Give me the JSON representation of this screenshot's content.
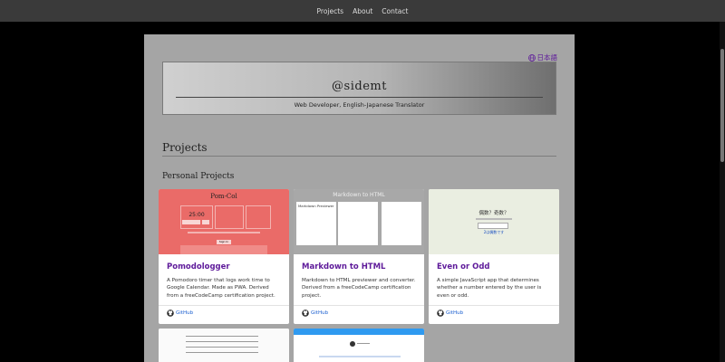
{
  "nav": {
    "items": [
      "Projects",
      "About",
      "Contact"
    ]
  },
  "language": {
    "label": "日本語",
    "icon": "globe-icon"
  },
  "hero": {
    "title": "@sidemt",
    "subtitle": "Web Developer, English-Japanese Translator"
  },
  "sections": {
    "projects": "Projects",
    "personal": "Personal Projects"
  },
  "cards": [
    {
      "title": "Pomodologger",
      "description": "A Pomodoro timer that logs work time to Google Calendar. Made as PWA. Derived from a freeCodeCamp certification project.",
      "link": "GitHub",
      "thumb": {
        "title": "Pom-Col",
        "time": "25:00",
        "button": "Sign In"
      }
    },
    {
      "title": "Markdown to HTML",
      "description": "Markdown to HTML previewer and converter. Derived from a freeCodeCamp certification project.",
      "link": "GitHub",
      "thumb": {
        "title": "Markdown to HTML",
        "pane": "Markdown Previewer"
      }
    },
    {
      "title": "Even or Odd",
      "description": "A simple JavaScript app that determines whether a number entered by the user is even or odd.",
      "link": "GitHub",
      "thumb": {
        "title": "偶数？奇数？",
        "result": "2は偶数です"
      }
    }
  ],
  "colors": {
    "link": "#5e1a9a",
    "github_link": "#1a5fd0",
    "panel": "#a5a5a5",
    "nav": "#3a3a3a"
  }
}
